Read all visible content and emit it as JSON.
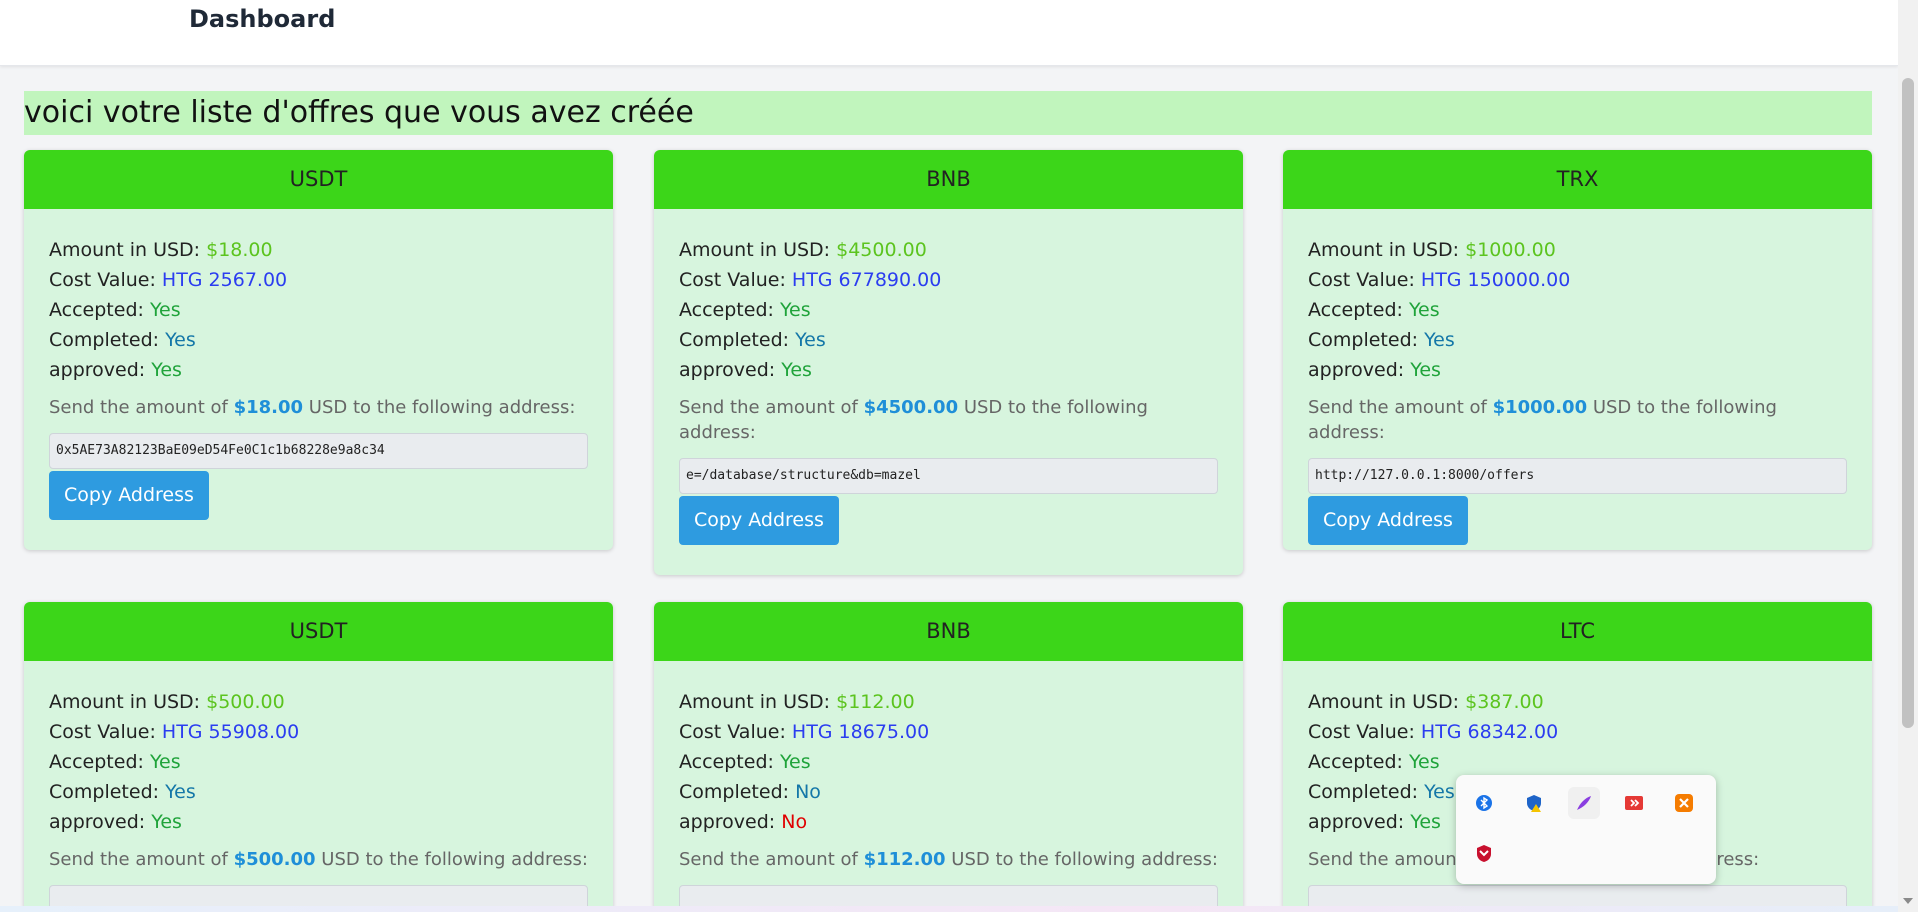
{
  "header": {
    "title": "Dashboard"
  },
  "heading": "voici votre liste d'offres que vous avez créée",
  "labels": {
    "amount": "Amount in USD:",
    "cost": "Cost Value:",
    "accepted": "Accepted:",
    "completed": "Completed:",
    "approved": "approved:",
    "send_prefix": "Send the amount of",
    "send_suffix": "USD to the following address:",
    "copy_button": "Copy Address"
  },
  "offers": [
    {
      "currency": "USDT",
      "amount": "$18.00",
      "cost": "HTG 2567.00",
      "accepted": "Yes",
      "completed": "Yes",
      "approved": "Yes",
      "send_amount": "$18.00",
      "address": "0x5AE73A82123BaE09eD54Fe0C1c1b68228e9a8c34"
    },
    {
      "currency": "BNB",
      "amount": "$4500.00",
      "cost": "HTG 677890.00",
      "accepted": "Yes",
      "completed": "Yes",
      "approved": "Yes",
      "send_amount": "$4500.00",
      "address": "e=/database/structure&db=mazel"
    },
    {
      "currency": "TRX",
      "amount": "$1000.00",
      "cost": "HTG 150000.00",
      "accepted": "Yes",
      "completed": "Yes",
      "approved": "Yes",
      "send_amount": "$1000.00",
      "address": "http://127.0.0.1:8000/offers"
    },
    {
      "currency": "USDT",
      "amount": "$500.00",
      "cost": "HTG 55908.00",
      "accepted": "Yes",
      "completed": "Yes",
      "approved": "Yes",
      "send_amount": "$500.00",
      "address": ""
    },
    {
      "currency": "BNB",
      "amount": "$112.00",
      "cost": "HTG 18675.00",
      "accepted": "Yes",
      "completed": "No",
      "approved": "No",
      "send_amount": "$112.00",
      "address": ""
    },
    {
      "currency": "LTC",
      "amount": "$387.00",
      "cost": "HTG 68342.00",
      "accepted": "Yes",
      "completed": "Yes",
      "approved": "Yes",
      "send_amount": "",
      "address": ""
    }
  ],
  "tray_icons": [
    "bluetooth-icon",
    "security-shield-icon",
    "feather-icon",
    "anydesk-icon",
    "xampp-icon",
    "mcafee-icon"
  ],
  "colors": {
    "card_header": "#3cd619",
    "card_body": "#d7f5de",
    "banner": "#c1f5bd",
    "button": "#2e9be0"
  }
}
